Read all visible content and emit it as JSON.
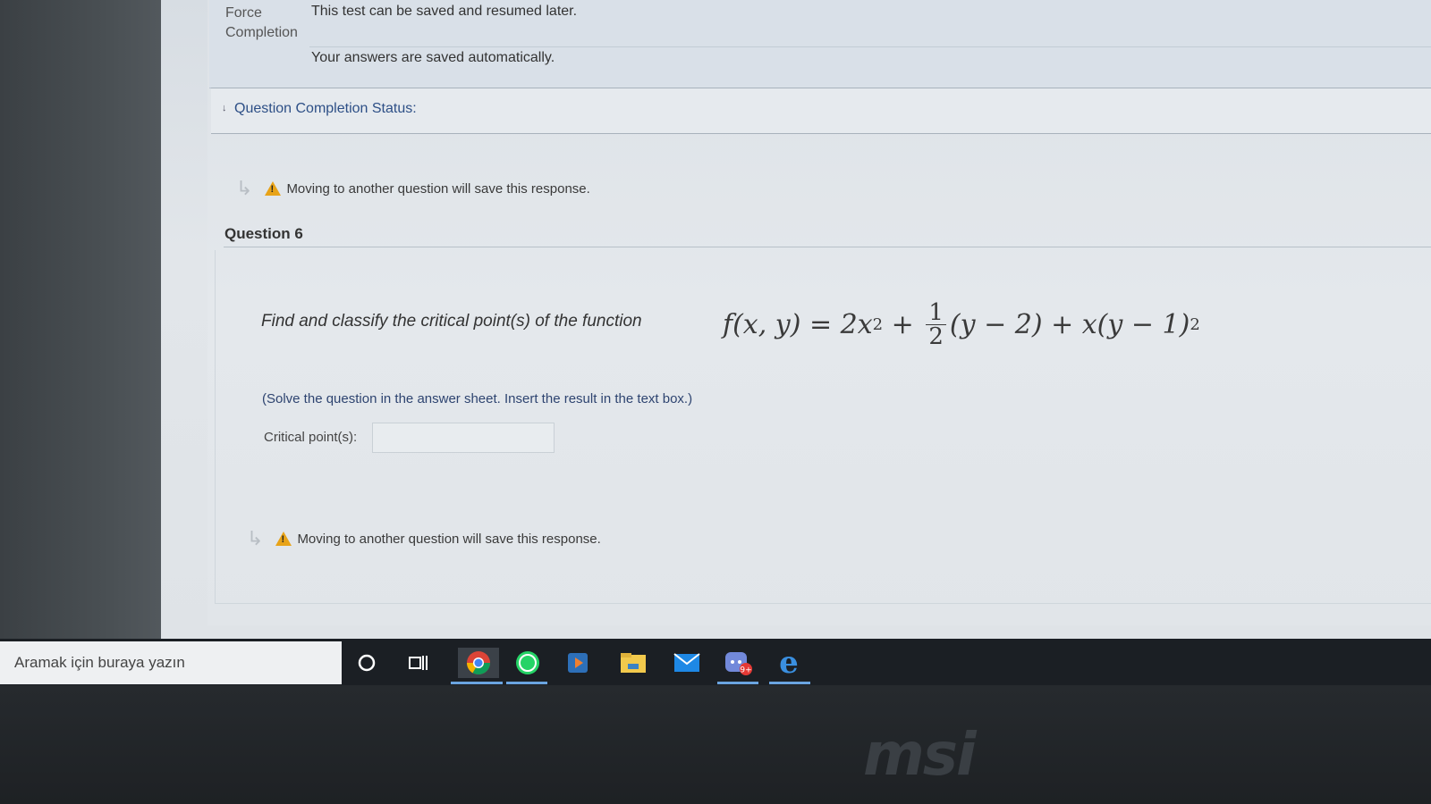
{
  "info": {
    "label_line1": "Force",
    "label_line2": "Completion",
    "value1": "This test can be saved and resumed later.",
    "value2": "Your answers are saved automatically."
  },
  "status": {
    "link": "Question Completion Status:"
  },
  "warning_text": "Moving to another question will save this response.",
  "question": {
    "title": "Question 6",
    "prompt": "Find and classify the critical point(s) of the function",
    "formula": {
      "lhs": "f(x, y) = 2x",
      "exp1": "2",
      "plus1": " + ",
      "frac_num": "1",
      "frac_den": "2",
      "mid": "(y − 2) + x(y − 1)",
      "exp2": "2"
    },
    "instruction": "(Solve the question in the answer sheet. Insert the result in the text box.)",
    "critical_label": "Critical point(s):",
    "critical_value": ""
  },
  "taskbar": {
    "search_placeholder": "Aramak için buraya yazın",
    "icons": [
      "cortana-icon",
      "task-view-icon",
      "chrome-icon",
      "whatsapp-icon",
      "media-player-icon",
      "file-explorer-icon",
      "mail-icon",
      "discord-icon",
      "edge-icon"
    ],
    "discord_badge": "9+"
  },
  "bezel": {
    "brand": "msi"
  }
}
